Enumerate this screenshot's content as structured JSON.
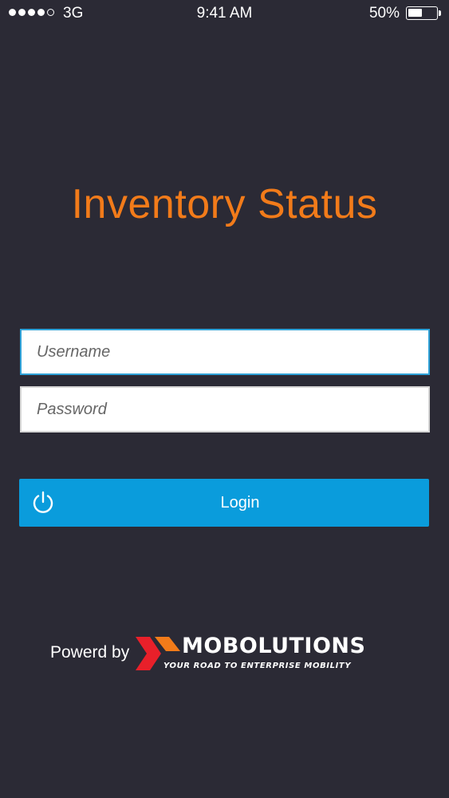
{
  "status_bar": {
    "signal_bars_filled": 4,
    "signal_bars_total": 5,
    "network": "3G",
    "time": "9:41 AM",
    "battery_percent_label": "50%",
    "battery_level": 0.5
  },
  "app": {
    "title": "Inventory Status",
    "title_color": "#f27b1a"
  },
  "form": {
    "username": {
      "value": "",
      "placeholder": "Username"
    },
    "password": {
      "value": "",
      "placeholder": "Password"
    },
    "login_label": "Login",
    "login_icon": "power-icon",
    "login_color": "#0a9cdc"
  },
  "footer": {
    "powered_by": "Powerd by",
    "brand": {
      "name": "MOBOLUTIONS",
      "tagline": "YOUR ROAD TO ENTERPRISE MOBILITY",
      "accent_colors": [
        "#e8202a",
        "#f27b1a"
      ]
    }
  }
}
